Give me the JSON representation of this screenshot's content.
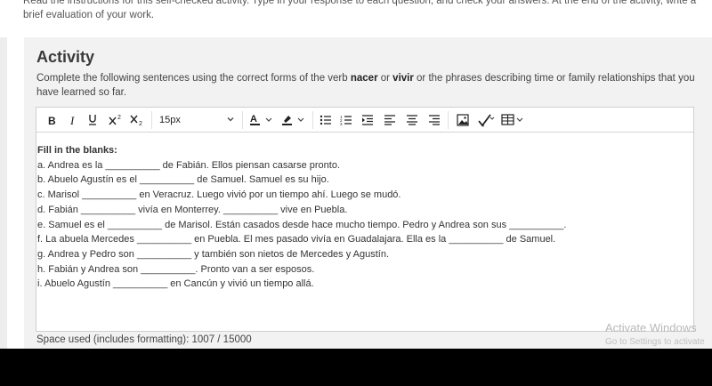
{
  "page": {
    "instructions": "Read the instructions for this self-checked activity. Type in your response to each question, and check your answers. At the end of the activity, write a brief evaluation of your work."
  },
  "activity": {
    "title": "Activity",
    "desc_pre": "Complete the following sentences using the correct forms of the verb ",
    "verb1": "nacer",
    "desc_or": " or ",
    "verb2": "vivir",
    "desc_post": " or the phrases describing time or family relationships that you have learned so far."
  },
  "toolbar": {
    "font_size": "15px",
    "icons": [
      "bold-icon",
      "italic-icon",
      "superscript-icon",
      "subscript-icon",
      "text-color-icon",
      "highlight-icon",
      "bulleted-list-icon",
      "numbered-list-icon",
      "indent-icon",
      "align-left-icon",
      "align-center-icon",
      "align-right-icon",
      "image-icon",
      "spellcheck-icon",
      "table-icon"
    ]
  },
  "editor": {
    "heading": "Fill in the blanks:",
    "lines": [
      "a. Andrea es la __________ de Fabián. Ellos piensan casarse pronto.",
      "b. Abuelo Agustín es el __________ de Samuel. Samuel es su hijo.",
      "c. Marisol __________ en Veracruz. Luego vivió por un tiempo ahí. Luego se mudó.",
      "d. Fabián __________ vivía en Monterrey. __________ vive en Puebla.",
      "e. Samuel es el __________ de Marisol. Están casados desde hace mucho tiempo. Pedro y Andrea son sus __________.",
      "f. La abuela Mercedes __________ en Puebla. El mes pasado vivía en Guadalajara. Ella es la __________ de Samuel.",
      "g. Andrea y Pedro son __________ y también son nietos de Mercedes y Agustín.",
      "h. Fabián y Andrea son __________. Pronto van a ser esposos.",
      "i. Abuelo Agustín __________ en Cancún y vivió un tiempo allá."
    ]
  },
  "status": {
    "space_used": "Space used (includes formatting): 1007 / 15000"
  },
  "watermark": {
    "line1": "Activate Windows",
    "line2": "Go to Settings to activate"
  },
  "colors": {
    "panel_bg": "#f2f2f2",
    "editor_border": "#cfcfcf"
  }
}
